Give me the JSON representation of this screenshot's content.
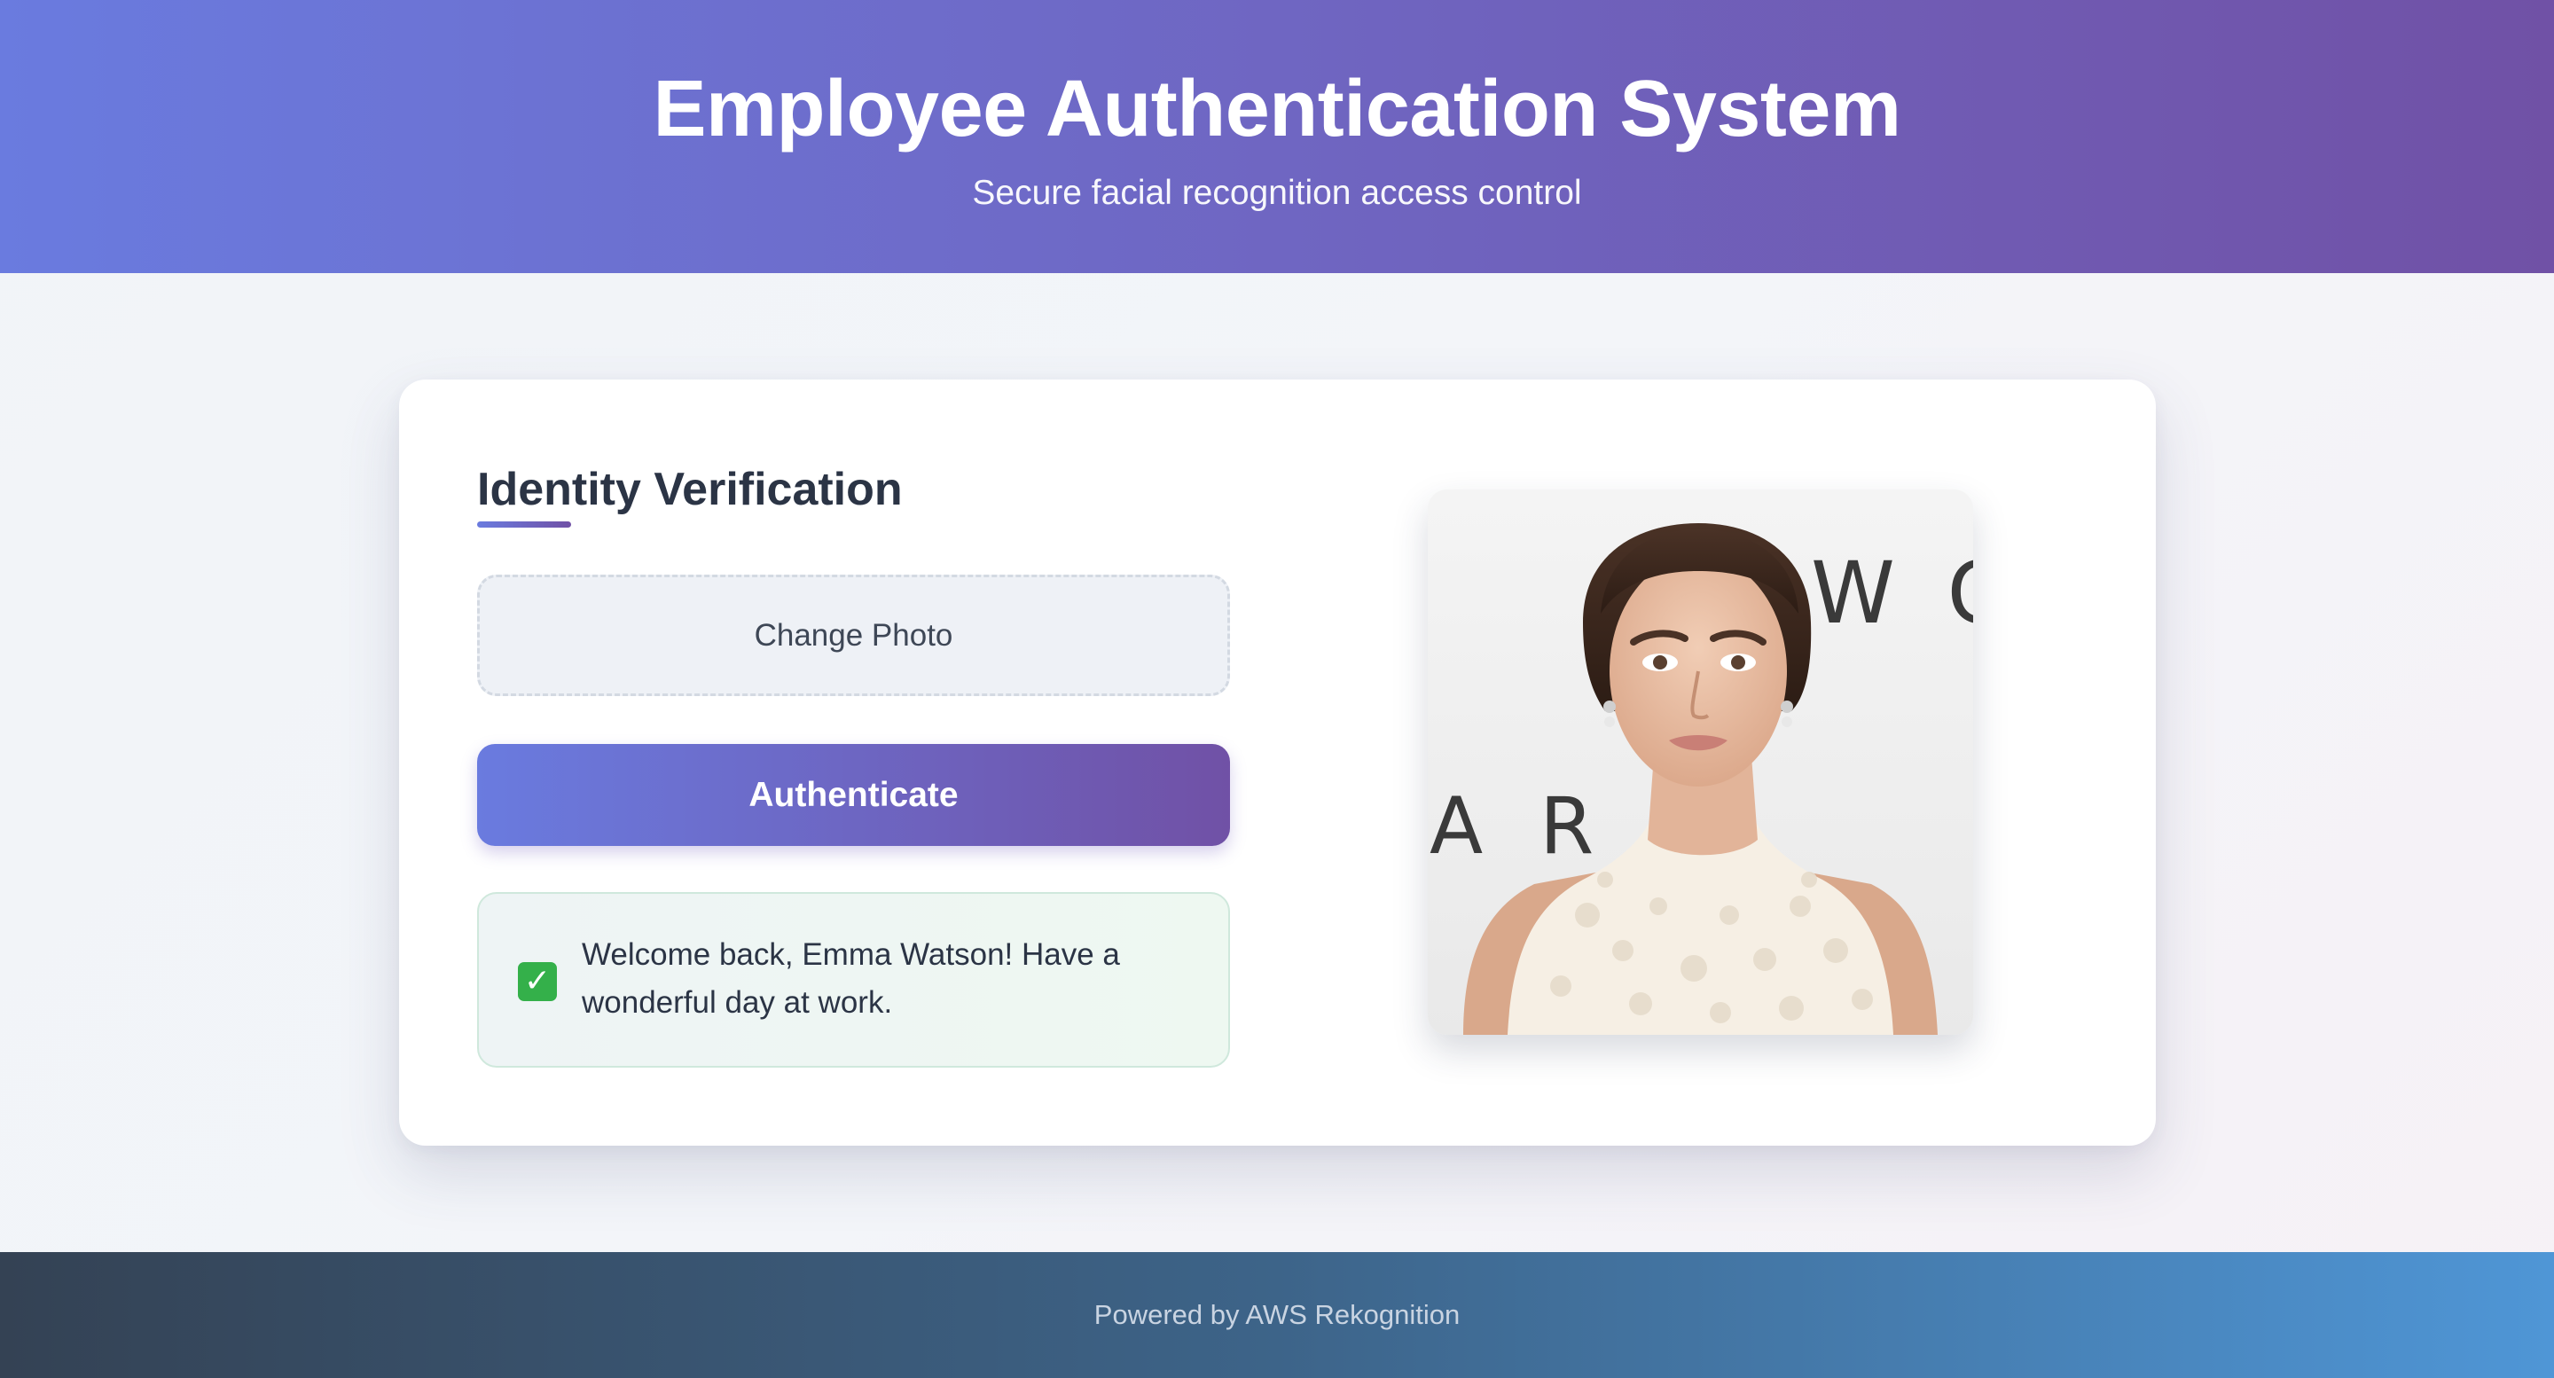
{
  "header": {
    "title": "Employee Authentication System",
    "subtitle": "Secure facial recognition access control"
  },
  "card": {
    "title": "Identity Verification",
    "change_photo_label": "Change Photo",
    "authenticate_label": "Authenticate",
    "result": {
      "icon": "check-mark-icon",
      "message": "Welcome back, Emma Watson! Have a wonderful day at work.",
      "status_color": "#34b04a"
    },
    "photo": {
      "backdrop_letters_top": "W C",
      "backdrop_letters_bottom": "A R"
    }
  },
  "footer": {
    "text": "Powered by AWS Rekognition"
  },
  "colors": {
    "accent_start": "#6a7bdf",
    "accent_end": "#7051a6",
    "footer_start": "#344254",
    "footer_end": "#4f96d6"
  }
}
